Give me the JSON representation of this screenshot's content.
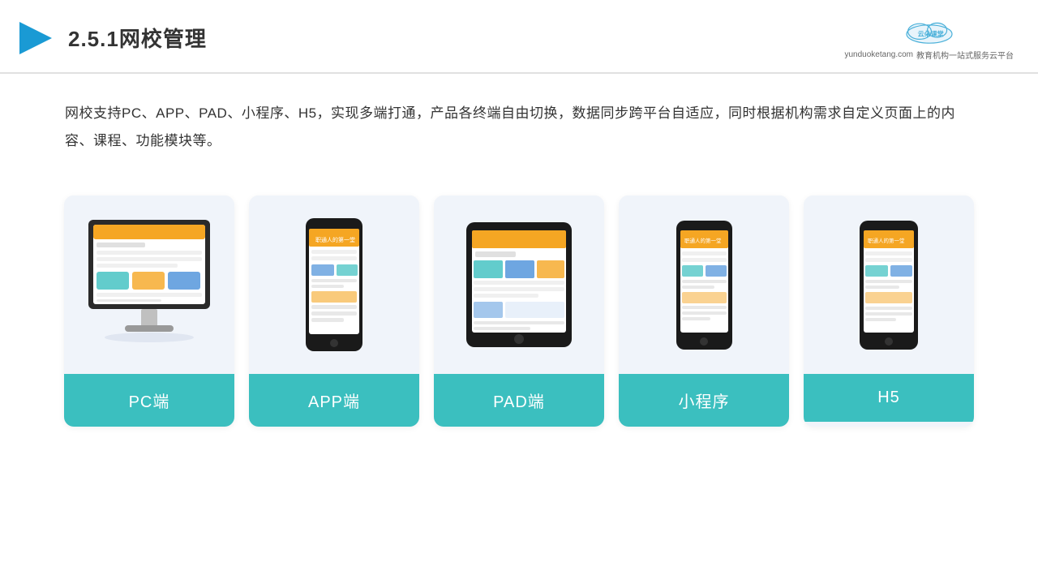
{
  "header": {
    "title": "2.5.1网校管理",
    "logo_url": "yunduoketang.com",
    "logo_slogan": "教育机构一站式服务云平台"
  },
  "description": {
    "text": "网校支持PC、APP、PAD、小程序、H5，实现多端打通，产品各终端自由切换，数据同步跨平台自适应，同时根据机构需求自定义页面上的内容、课程、功能模块等。"
  },
  "cards": [
    {
      "id": "pc",
      "label": "PC端"
    },
    {
      "id": "app",
      "label": "APP端"
    },
    {
      "id": "pad",
      "label": "PAD端"
    },
    {
      "id": "miniapp",
      "label": "小程序"
    },
    {
      "id": "h5",
      "label": "H5"
    }
  ]
}
